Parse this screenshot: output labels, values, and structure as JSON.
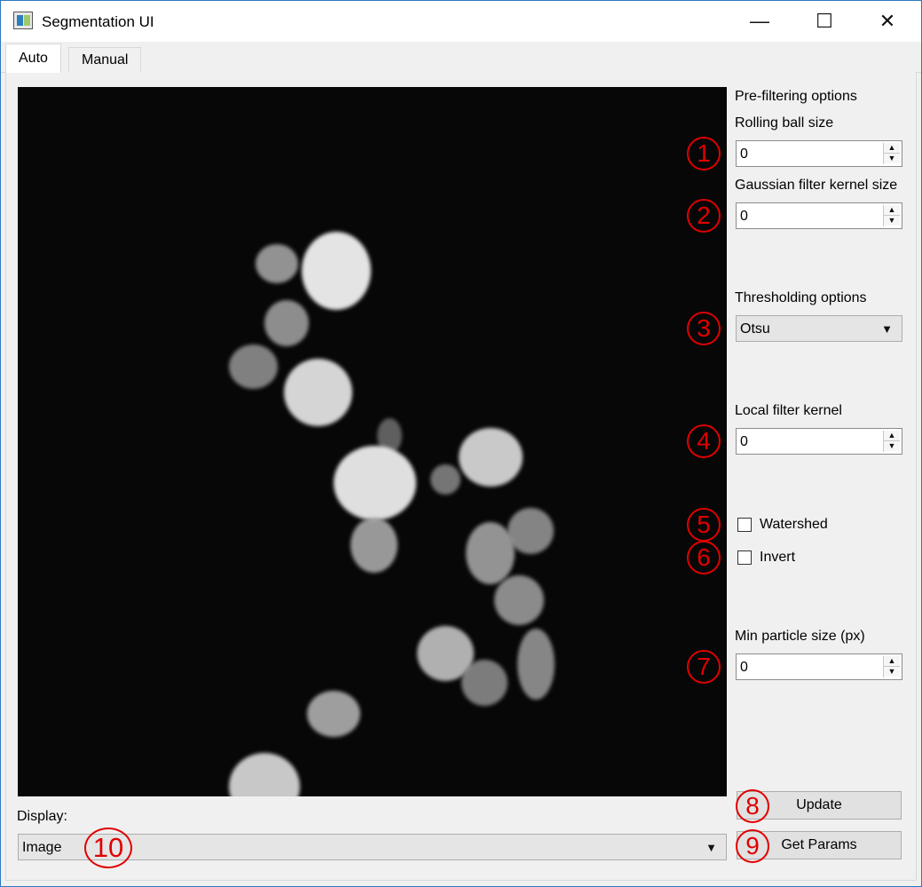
{
  "window": {
    "title": "Segmentation UI"
  },
  "window_controls": {
    "minimize": "—",
    "maximize": "☐",
    "close": "✕"
  },
  "tabs": [
    {
      "label": "Auto"
    },
    {
      "label": "Manual"
    }
  ],
  "image_view": {
    "content": "grayscale microscopy image of bright particles"
  },
  "options": {
    "prefilter_title": "Pre-filtering options",
    "rolling_ball_label": "Rolling ball size",
    "rolling_ball_value": "0",
    "gaussian_label": "Gaussian filter kernel size",
    "gaussian_value": "0",
    "threshold_title": "Thresholding options",
    "threshold_method": "Otsu",
    "local_filter_label": "Local filter kernel",
    "local_filter_value": "0",
    "watershed_label": "Watershed",
    "invert_label": "Invert",
    "min_particle_label": "Min particle size (px)",
    "min_particle_value": "0",
    "update_label": "Update",
    "get_params_label": "Get Params"
  },
  "display": {
    "label": "Display:",
    "value": "Image"
  },
  "markers": [
    "1",
    "2",
    "3",
    "4",
    "5",
    "6",
    "7",
    "8",
    "9",
    "10"
  ],
  "colors": {
    "window_border": "#2b78c2",
    "marker": "#e00000"
  }
}
